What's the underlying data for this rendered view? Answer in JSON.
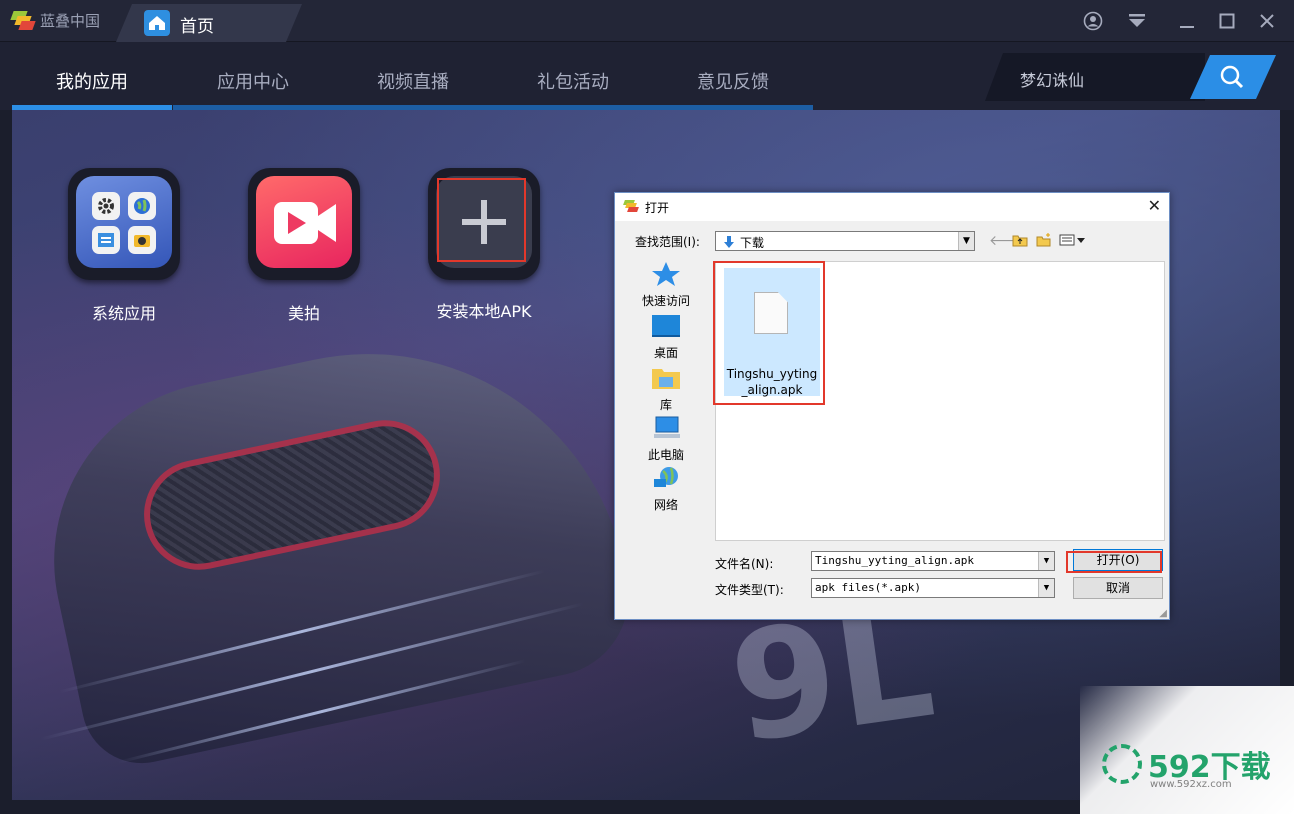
{
  "window": {
    "app_title": "蓝叠中国",
    "tab_label": "首页",
    "controls": [
      "user-icon",
      "menu-icon",
      "minimize-icon",
      "maximize-icon",
      "close-icon"
    ]
  },
  "nav": {
    "items": [
      "我的应用",
      "应用中心",
      "视频直播",
      "礼包活动",
      "意见反馈"
    ],
    "active": "我的应用",
    "search_text": "梦幻诛仙"
  },
  "apps": [
    {
      "label": "系统应用"
    },
    {
      "label": "美拍"
    },
    {
      "label": "安装本地APK"
    }
  ],
  "dialog": {
    "title": "打开",
    "lookin_label": "查找范围(I):",
    "lookin_value": "下载",
    "places": [
      "快速访问",
      "桌面",
      "库",
      "此电脑",
      "网络"
    ],
    "file": {
      "name": "Tingshu_yyting_align.apk"
    },
    "filename_label": "文件名(N):",
    "filename_value": "Tingshu_yyting_align.apk",
    "filetype_label": "文件类型(T):",
    "filetype_value": "apk files(*.apk)",
    "open_button": "打开(O)",
    "cancel_button": "取消"
  },
  "watermark": {
    "brand": "592下载",
    "url": "www.592xz.com"
  },
  "colors": {
    "accent": "#2c8fe6",
    "highlight": "#e2382b",
    "titlebar": "#232637"
  }
}
